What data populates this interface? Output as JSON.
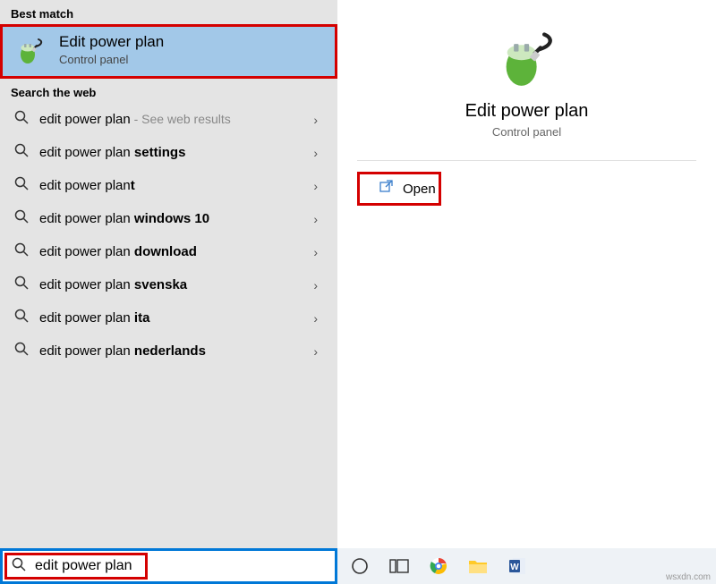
{
  "sections": {
    "best_match": "Best match",
    "search_web": "Search the web"
  },
  "best_match": {
    "title": "Edit power plan",
    "subtitle": "Control panel"
  },
  "web_results": [
    {
      "prefix": "edit power plan",
      "bold": "",
      "hint": " - See web results"
    },
    {
      "prefix": "edit power plan ",
      "bold": "settings",
      "hint": ""
    },
    {
      "prefix": "edit power plan",
      "bold": "t",
      "hint": ""
    },
    {
      "prefix": "edit power plan ",
      "bold": "windows 10",
      "hint": ""
    },
    {
      "prefix": "edit power plan ",
      "bold": "download",
      "hint": ""
    },
    {
      "prefix": "edit power plan ",
      "bold": "svenska",
      "hint": ""
    },
    {
      "prefix": "edit power plan ",
      "bold": "ita",
      "hint": ""
    },
    {
      "prefix": "edit power plan ",
      "bold": "nederlands",
      "hint": ""
    }
  ],
  "detail": {
    "title": "Edit power plan",
    "subtitle": "Control panel",
    "open": "Open"
  },
  "search_input": {
    "value": "edit power plan"
  },
  "watermark": "wsxdn.com",
  "taskbar_icons": [
    "cortana",
    "task-view",
    "chrome",
    "file-explorer",
    "word"
  ]
}
